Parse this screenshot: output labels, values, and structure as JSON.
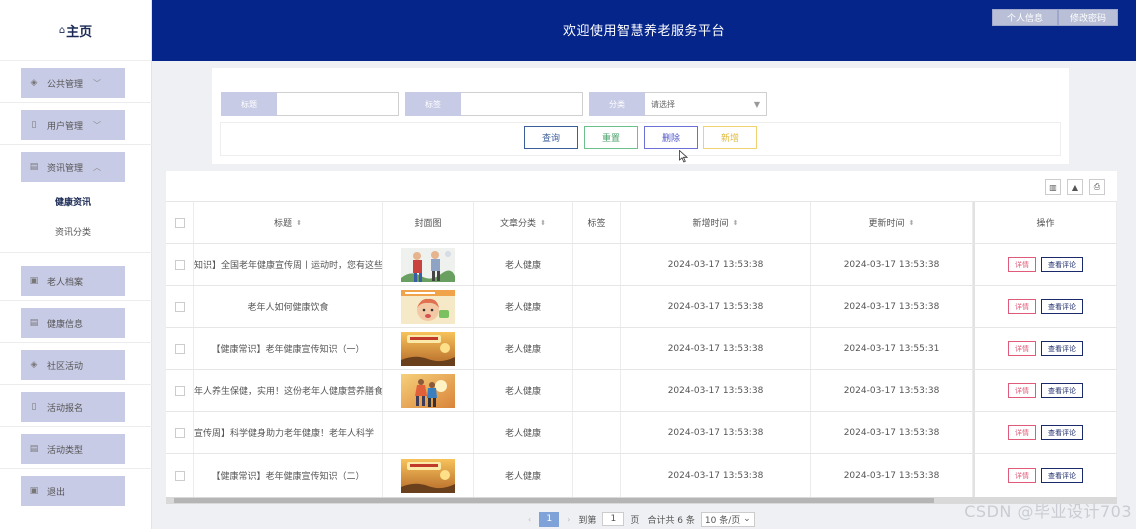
{
  "sidebar": {
    "brand": "主页",
    "brand_icon": "home-icon",
    "items": [
      {
        "label": "公共管理",
        "icon": "layers-icon",
        "chevron": "﹀"
      },
      {
        "label": "用户管理",
        "icon": "trash-icon",
        "chevron": "﹀"
      },
      {
        "label": "资讯管理",
        "icon": "grid-icon",
        "chevron": "︿"
      },
      {
        "label": "老人档案",
        "icon": "file-icon"
      },
      {
        "label": "健康信息",
        "icon": "grid-icon"
      },
      {
        "label": "社区活动",
        "icon": "layers-icon"
      },
      {
        "label": "活动报名",
        "icon": "trash-icon"
      },
      {
        "label": "活动类型",
        "icon": "grid-icon"
      },
      {
        "label": "退出",
        "icon": "file-icon"
      }
    ],
    "sub_items": [
      {
        "label": "健康资讯",
        "active": true
      },
      {
        "label": "资讯分类",
        "active": false
      }
    ]
  },
  "header": {
    "title": "欢迎使用智慧养老服务平台",
    "profile_button": "个人信息",
    "password_button": "修改密码"
  },
  "search": {
    "field1_label": "标题",
    "field1_value": "",
    "field2_label": "标签",
    "field2_value": "",
    "field3_label": "分类",
    "field3_value": "请选择",
    "query_button": "查询",
    "reset_button": "重置",
    "delete_button": "删除",
    "add_button": "新增"
  },
  "table": {
    "columns": [
      "标题",
      "封面图",
      "文章分类",
      "标签",
      "新增时间",
      "更新时间",
      "操作"
    ],
    "rows": [
      {
        "title": "知识】全国老年健康宣传周丨运动时，您有这些",
        "category": "老人健康",
        "tag": "",
        "created": "2024-03-17 13:53:38",
        "updated": "2024-03-17 13:53:38",
        "cover": "elderly-exercise"
      },
      {
        "title": "老年人如何健康饮食",
        "category": "老人健康",
        "tag": "",
        "created": "2024-03-17 13:53:38",
        "updated": "2024-03-17 13:53:38",
        "cover": "woman-eating"
      },
      {
        "title": "【健康常识】老年健康宣传知识（一）",
        "category": "老人健康",
        "tag": "",
        "created": "2024-03-17 13:53:38",
        "updated": "2024-03-17 13:55:31",
        "cover": "sunset-banner"
      },
      {
        "title": "年人养生保健，实用！这份老年人健康营养膳食",
        "category": "老人健康",
        "tag": "",
        "created": "2024-03-17 13:53:38",
        "updated": "2024-03-17 13:53:38",
        "cover": "elderly-sunset"
      },
      {
        "title": "宣传周】科学健身助力老年健康！老年人科学",
        "category": "老人健康",
        "tag": "",
        "created": "2024-03-17 13:53:38",
        "updated": "2024-03-17 13:53:38",
        "cover": ""
      },
      {
        "title": "【健康常识】老年健康宣传知识（二）",
        "category": "老人健康",
        "tag": "",
        "created": "2024-03-17 13:53:38",
        "updated": "2024-03-17 13:53:38",
        "cover": "sunset-banner"
      }
    ],
    "detail_button": "详情",
    "comment_button": "查看评论",
    "tools": [
      "columns-icon",
      "export-icon",
      "print-icon"
    ]
  },
  "pager": {
    "current_page": "1",
    "goto_label": "到第",
    "goto_value": "1",
    "page_unit": "页",
    "total_text": "合计共 6 条",
    "page_size": "10 条/页"
  },
  "watermark": "CSDN @毕业设计703",
  "colors": {
    "header_bg": "#06258a",
    "menu_bg": "#c8cbe6",
    "query_border": "#3b5f9a",
    "reset_border": "#6cc08b",
    "delete_border": "#6b6fd6",
    "add_border": "#f0d26e",
    "detail_border": "#e05b7a",
    "comment_border": "#1b2a6b"
  }
}
